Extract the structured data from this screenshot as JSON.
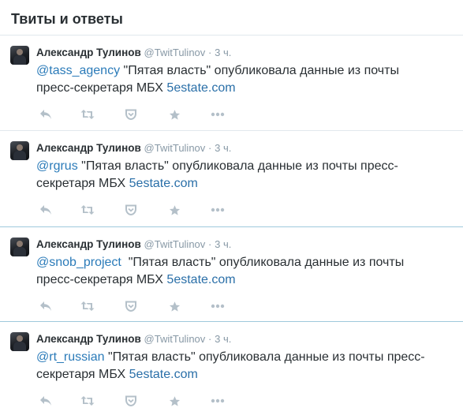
{
  "header": {
    "title": "Твиты и ответы"
  },
  "tweets": [
    {
      "name": "Александр Тулинов",
      "handle": "@TwitTulinov",
      "dot": "·",
      "time": "3 ч.",
      "mention": "@tass_agency",
      "text": " \"Пятая власть\" опубликовала данные из почты пресс-секретаря МБХ ",
      "link": "5estate.com"
    },
    {
      "name": "Александр Тулинов",
      "handle": "@TwitTulinov",
      "dot": "·",
      "time": "3 ч.",
      "mention": "@rgrus",
      "text": " \"Пятая власть\" опубликовала данные из почты пресс-секретаря МБХ ",
      "link": "5estate.com"
    },
    {
      "name": "Александр Тулинов",
      "handle": "@TwitTulinov",
      "dot": "·",
      "time": "3 ч.",
      "mention": "@snob_project",
      "text": "  \"Пятая власть\" опубликовала данные из почты пресс-секретаря МБХ ",
      "link": "5estate.com"
    },
    {
      "name": "Александр Тулинов",
      "handle": "@TwitTulinov",
      "dot": "·",
      "time": "3 ч.",
      "mention": "@rt_russian",
      "text": " \"Пятая власть\" опубликовала данные из почты пресс-секретаря МБХ ",
      "link": "5estate.com"
    }
  ],
  "icons": {
    "reply": "reply-icon",
    "retweet": "retweet-icon",
    "favorite": "pocket-icon",
    "star": "star-icon",
    "more": "more-icon"
  },
  "colors": {
    "link": "#2b7bb9",
    "muted": "#8899a6",
    "action": "#b4c0c9",
    "divider_active": "#9fc9dc"
  }
}
